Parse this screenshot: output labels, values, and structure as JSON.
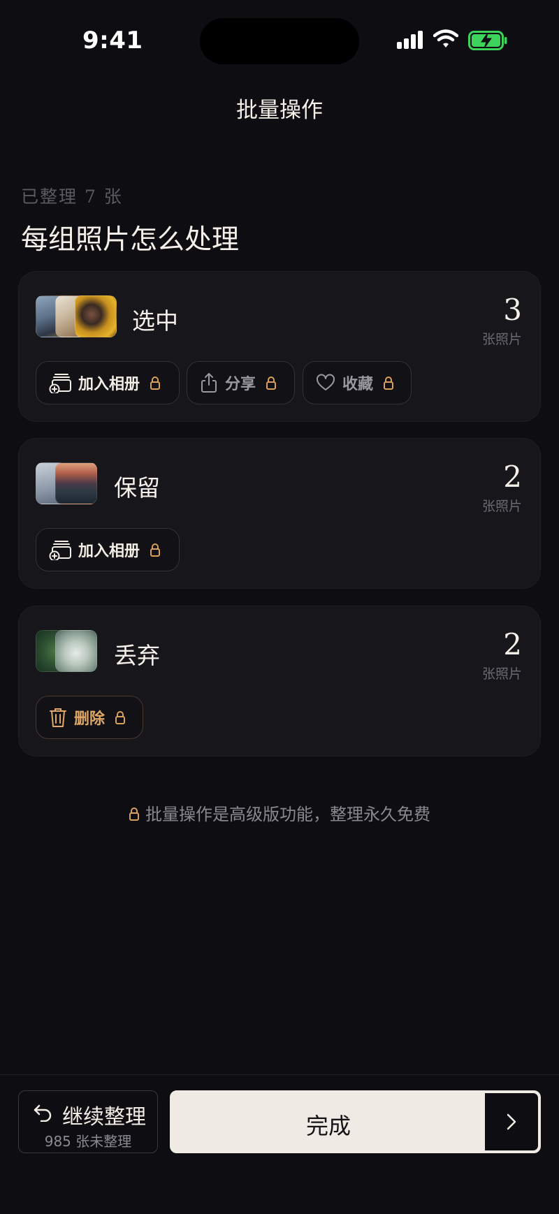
{
  "status_bar": {
    "time": "9:41"
  },
  "nav": {
    "title": "批量操作"
  },
  "summary": "已整理 7 张",
  "heading": "每组照片怎么处理",
  "groups": [
    {
      "label": "选中",
      "count": "3",
      "unit": "张照片",
      "actions": [
        {
          "label": "加入相册",
          "icon": "add-to-album-icon",
          "locked": true
        },
        {
          "label": "分享",
          "icon": "share-icon",
          "locked": true
        },
        {
          "label": "收藏",
          "icon": "heart-icon",
          "locked": true
        }
      ]
    },
    {
      "label": "保留",
      "count": "2",
      "unit": "张照片",
      "actions": [
        {
          "label": "加入相册",
          "icon": "add-to-album-icon",
          "locked": true
        }
      ]
    },
    {
      "label": "丢弃",
      "count": "2",
      "unit": "张照片",
      "actions": [
        {
          "label": "删除",
          "icon": "trash-icon",
          "locked": true
        }
      ]
    }
  ],
  "premium_note": "批量操作是高级版功能，整理永久免费",
  "footer": {
    "continue_label": "继续整理",
    "continue_sub": "985 张未整理",
    "done_label": "完成"
  },
  "colors": {
    "background": "#0e0d11",
    "card": "#17161b",
    "accent_lock": "#d9a05b",
    "danger": "#e0a866",
    "battery": "#3dd45c",
    "done_button": "#efebe4"
  }
}
